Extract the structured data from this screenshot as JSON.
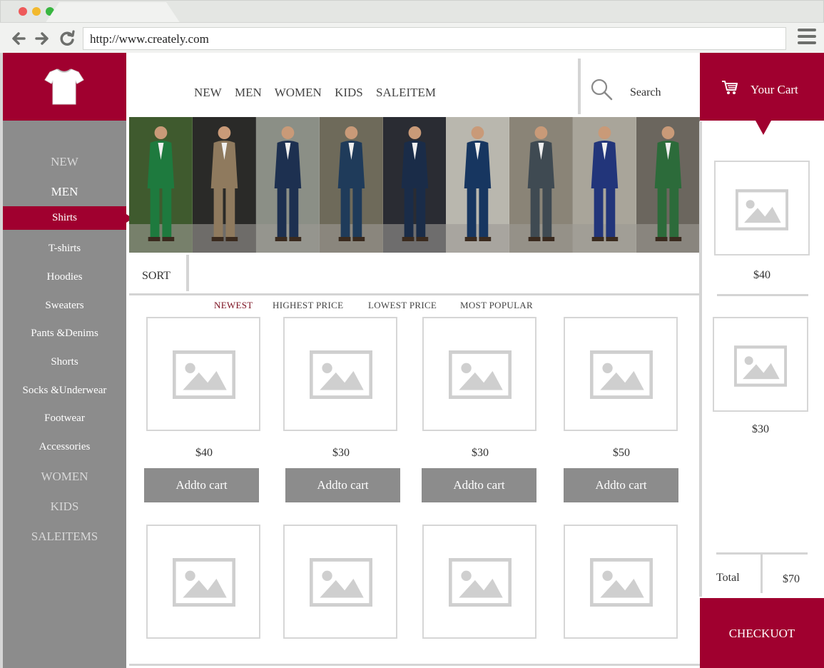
{
  "browser": {
    "url": "http://www.creately.com"
  },
  "colors": {
    "brand": "#a0002f",
    "sidebar": "#8c8c8c",
    "placeholder": "#d6d6d6"
  },
  "sidebar": {
    "logo_icon": "tshirt-icon",
    "items": [
      {
        "label": "NEW",
        "type": "category"
      },
      {
        "label": "MEN",
        "type": "category",
        "active": true
      },
      {
        "label": "Shirts",
        "type": "sub",
        "selected": true
      },
      {
        "label": "T-shirts",
        "type": "sub"
      },
      {
        "label": "Hoodies",
        "type": "sub"
      },
      {
        "label": "Sweaters",
        "type": "sub"
      },
      {
        "label": "Pants   &Denims",
        "type": "sub"
      },
      {
        "label": "Shorts",
        "type": "sub"
      },
      {
        "label": "Socks  &Underwear",
        "type": "sub"
      },
      {
        "label": "Footwear",
        "type": "sub"
      },
      {
        "label": "Accessories",
        "type": "sub"
      },
      {
        "label": "WOMEN",
        "type": "category"
      },
      {
        "label": "KIDS",
        "type": "category"
      },
      {
        "label": "SALEITEMS",
        "type": "category"
      }
    ]
  },
  "topnav": {
    "items": [
      "NEW",
      "MEN",
      "WOMEN",
      "KIDS",
      "SALEITEM"
    ]
  },
  "search": {
    "label": "Search",
    "icon": "search-icon"
  },
  "sort": {
    "label": "SORT",
    "options": [
      "NEWEST",
      "HIGHEST  PRICE",
      "LOWEST  PRICE",
      "MOST  POPULAR"
    ],
    "active": "NEWEST"
  },
  "products": [
    {
      "price": "$40",
      "button": "Addto cart"
    },
    {
      "price": "$30",
      "button": "Addto cart"
    },
    {
      "price": "$30",
      "button": "Addto cart"
    },
    {
      "price": "$50",
      "button": "Addto cart"
    }
  ],
  "cart": {
    "title": "Your Cart",
    "icon": "cart-icon",
    "items": [
      {
        "price": "$40"
      },
      {
        "price": "$30"
      }
    ],
    "total_label": "Total",
    "total_value": "$70",
    "checkout_label": "CHECKUOT"
  }
}
